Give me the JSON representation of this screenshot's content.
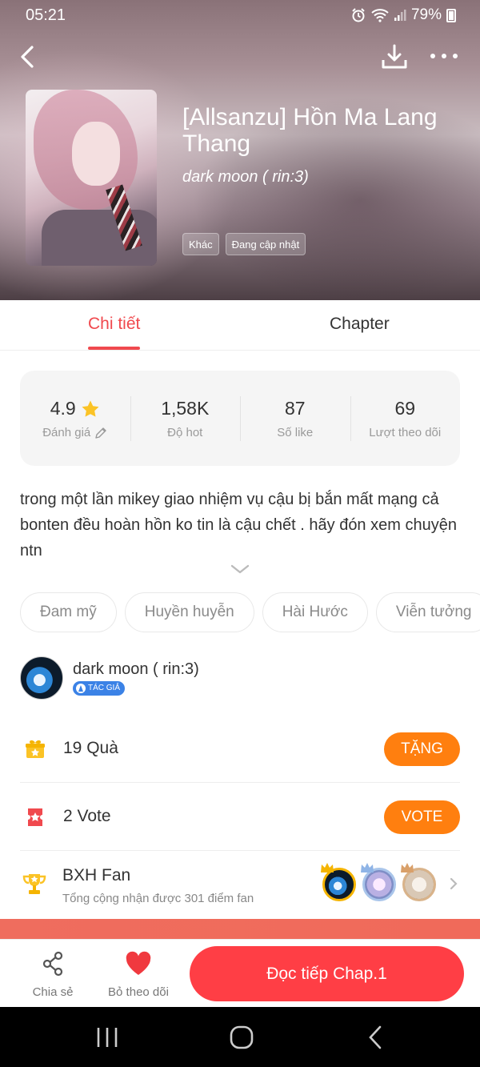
{
  "status_bar": {
    "time": "05:21",
    "battery": "79%"
  },
  "header": {
    "title": "[Allsanzu] Hồn Ma Lang Thang",
    "author": "dark moon ( rin:3)",
    "tags": [
      "Khác",
      "Đang cập nhật"
    ]
  },
  "tabs": {
    "active": "Chi tiết",
    "other": "Chapter"
  },
  "stats": {
    "rating": {
      "value": "4.9",
      "label": "Đánh giá"
    },
    "hot": {
      "value": "1,58K",
      "label": "Độ hot"
    },
    "likes": {
      "value": "87",
      "label": "Số like"
    },
    "follows": {
      "value": "69",
      "label": "Lượt theo dõi"
    }
  },
  "description": "trong một lần mikey giao nhiệm vụ cậu bị bắn mất mạng cả bonten đều hoàn hồn ko tin là cậu chết . hãy đón xem chuyện ntn",
  "genres": [
    "Đam mỹ",
    "Huyền huyễn",
    "Hài Hước",
    "Viễn tưởng"
  ],
  "author_section": {
    "name": "dark moon ( rin:3)",
    "badge": "TÁC GIẢ"
  },
  "gifts": {
    "count": "19",
    "label": "Quà",
    "button": "TẶNG"
  },
  "votes": {
    "count": "2",
    "label": "Vote",
    "button": "VOTE"
  },
  "fan_ranking": {
    "title": "BXH Fan",
    "subtitle": "Tổng cộng nhận được 301 điểm fan"
  },
  "bottom_bar": {
    "share": "Chia sẻ",
    "unfollow": "Bỏ theo dõi",
    "read": "Đọc tiếp Chap.1"
  },
  "colors": {
    "accent": "#f0494e",
    "orange": "#ff7f0f",
    "read_button": "#ff3e45"
  }
}
